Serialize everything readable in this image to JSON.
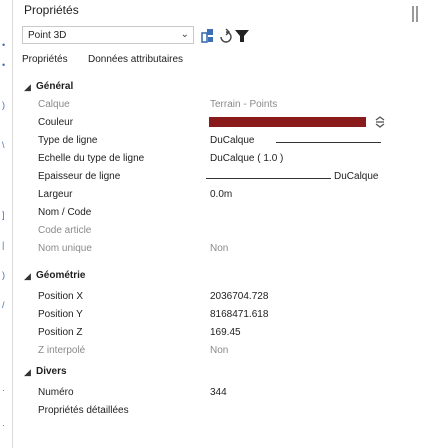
{
  "panel": {
    "title": "Propriétés",
    "selector": {
      "value": "Point 3D"
    },
    "toolbar_icons": [
      "quick-select-icon",
      "toggle-pickadd-icon",
      "filter-icon"
    ],
    "tabs": [
      {
        "label": "Propriétés"
      },
      {
        "label": "Données attributaires"
      }
    ]
  },
  "accent_color": "#3d6fb4",
  "layer_color": "#8b1a1a",
  "categories": {
    "general": {
      "label": "Général",
      "props": {
        "calque": {
          "label": "Calque",
          "value": "Terrain - Points"
        },
        "couleur": {
          "label": "Couleur"
        },
        "type_ligne": {
          "label": "Type de ligne",
          "value": "DuCalque"
        },
        "echelle_type_ligne": {
          "label": "Echelle du type de ligne",
          "value": "DuCalque ( 1.0 )"
        },
        "epaisseur_ligne": {
          "label": "Epaisseur de ligne",
          "value": "DuCalque"
        },
        "largeur": {
          "label": "Largeur",
          "value": "0.0m"
        },
        "nom_code": {
          "label": "Nom / Code",
          "value": ""
        },
        "code_article": {
          "label": "Code article",
          "value": ""
        },
        "nom_unique": {
          "label": "Nom unique",
          "value": "Non"
        }
      }
    },
    "geometrie": {
      "label": "Géométrie",
      "props": {
        "position_x": {
          "label": "Position X",
          "value": "2036704.728"
        },
        "position_y": {
          "label": "Position Y",
          "value": "8168471.618"
        },
        "position_z": {
          "label": "Position Z",
          "value": "169.45"
        },
        "z_interpole": {
          "label": "Z interpolé",
          "value": "Non"
        }
      }
    },
    "divers": {
      "label": "Divers",
      "props": {
        "numero": {
          "label": "Numéro",
          "value": "344"
        },
        "proprietes_detaillees": {
          "label": "Propriétés détaillées",
          "value": ""
        }
      }
    }
  }
}
